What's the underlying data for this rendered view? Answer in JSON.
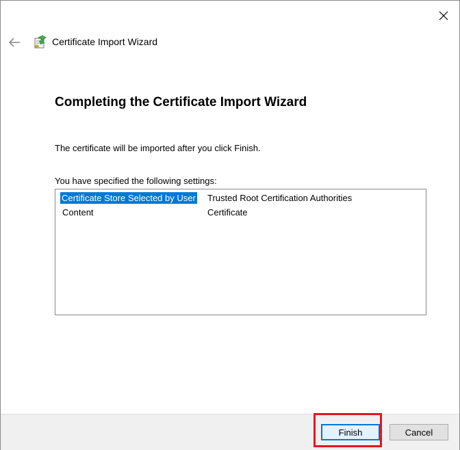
{
  "window": {
    "close_icon": "close-icon"
  },
  "header": {
    "back_icon": "back-arrow-icon",
    "wizard_icon": "certificate-icon",
    "title": "Certificate Import Wizard"
  },
  "main": {
    "heading": "Completing the Certificate Import Wizard",
    "description": "The certificate will be imported after you click Finish.",
    "settings_label": "You have specified the following settings:",
    "settings": [
      {
        "key": "Certificate Store Selected by User",
        "value": "Trusted Root Certification Authorities",
        "selected": true
      },
      {
        "key": "Content",
        "value": "Certificate",
        "selected": false
      }
    ]
  },
  "footer": {
    "finish_label": "Finish",
    "cancel_label": "Cancel"
  },
  "colors": {
    "selection": "#0078d7",
    "highlight_box": "#e81123",
    "footer_bg": "#f0f0f0"
  }
}
